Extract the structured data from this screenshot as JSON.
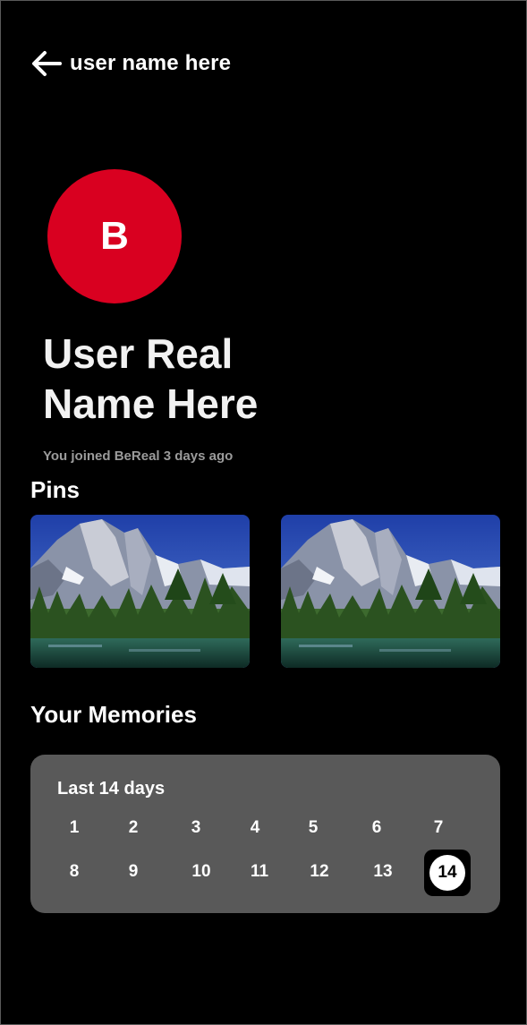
{
  "header": {
    "back_icon": "arrow-left-icon",
    "username": "user name here"
  },
  "profile": {
    "avatar_initial": "B",
    "avatar_color": "#d90020",
    "real_name": "User Real Name Here",
    "joined_text": "You joined BeReal 3 days ago"
  },
  "pins": {
    "title": "Pins",
    "items": [
      {
        "image": "mountain-lake-photo"
      },
      {
        "image": "mountain-lake-photo"
      }
    ]
  },
  "memories": {
    "title": "Your Memories",
    "card_label": "Last 14 days",
    "days": [
      "1",
      "2",
      "3",
      "4",
      "5",
      "6",
      "7",
      "8",
      "9",
      "10",
      "11",
      "12",
      "13",
      "14"
    ],
    "current_day": "14"
  }
}
